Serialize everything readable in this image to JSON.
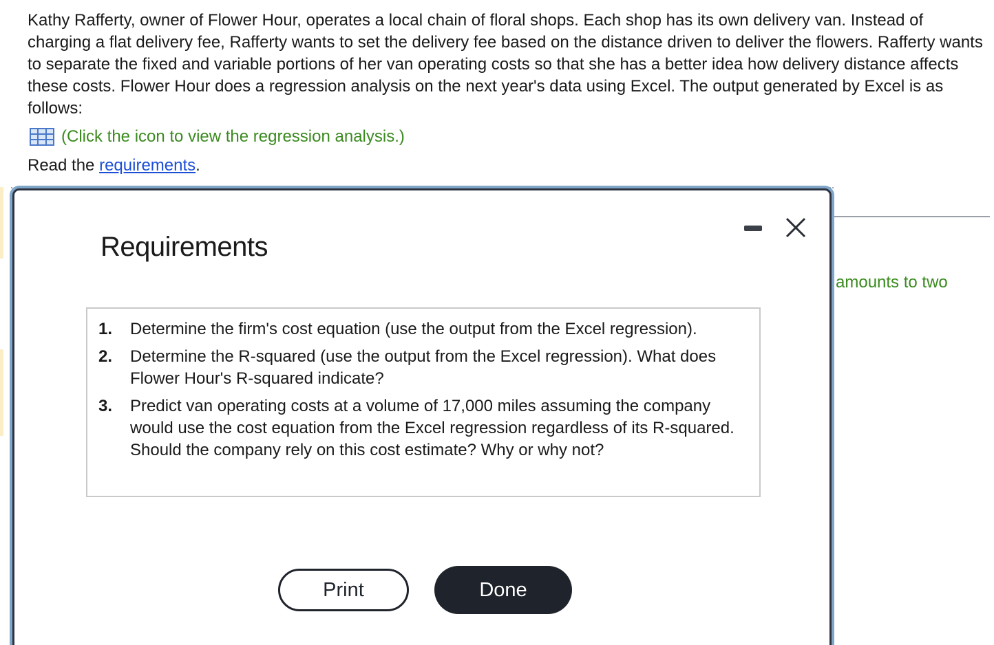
{
  "intro": {
    "text": "Kathy Rafferty, owner of Flower Hour, operates a local chain of floral shops. Each shop has its own delivery van. Instead of charging a flat delivery fee, Rafferty wants to set the delivery fee based on the distance driven to deliver the flowers. Rafferty wants to separate the fixed and variable portions of her van operating costs so that she has a better idea how delivery distance affects these costs. Flower Hour does a regression analysis on the next year's data using Excel. The output generated by Excel is as follows:"
  },
  "regression_link": {
    "icon": "grid-table-icon",
    "label": "(Click the icon to view the regression analysis.)"
  },
  "read_line": {
    "prefix": "Read the ",
    "link_label": "requirements",
    "suffix": "."
  },
  "background_partial": {
    "text": "amounts to two"
  },
  "modal": {
    "title": "Requirements",
    "minimize_icon": "minimize-icon",
    "close_icon": "close-icon",
    "requirements": [
      {
        "number": "1.",
        "text": "Determine the firm's cost equation (use the output from the Excel regression)."
      },
      {
        "number": "2.",
        "text": "Determine the R-squared (use the output from the Excel regression). What does Flower Hour's R-squared indicate?"
      },
      {
        "number": "3.",
        "text": "Predict van operating costs at a volume of 17,000 miles assuming the company would use the cost equation from the Excel regression regardless of its R-squared. Should the company rely on this cost estimate? Why or why not?"
      }
    ],
    "print_label": "Print",
    "done_label": "Done"
  },
  "colors": {
    "link_green": "#3a8a1f",
    "link_blue": "#1b4fd6",
    "dark_button": "#1f232b"
  }
}
